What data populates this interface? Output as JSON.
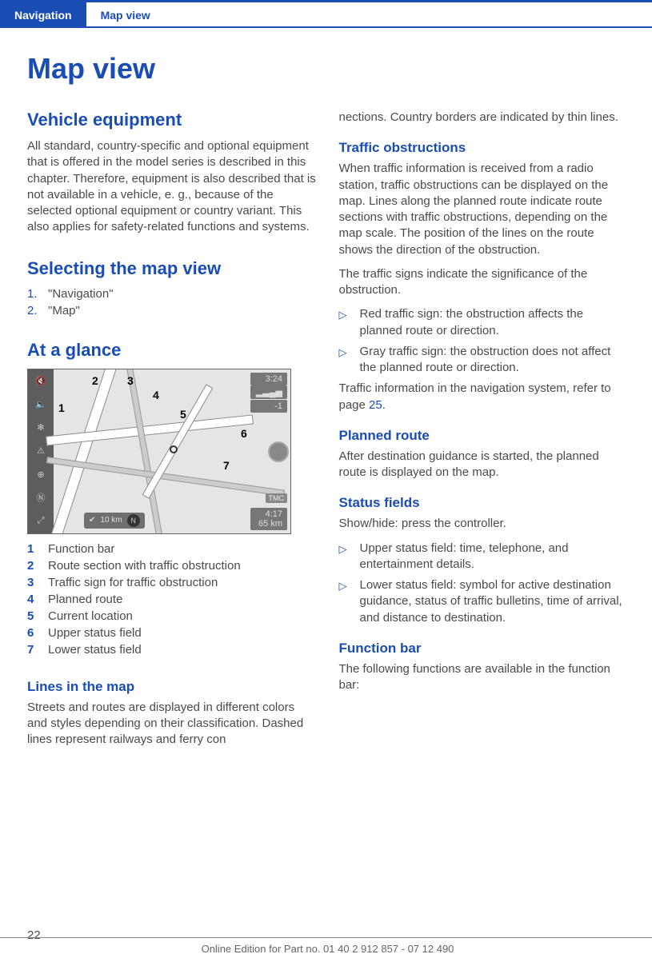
{
  "tabs": {
    "primary": "Navigation",
    "secondary": "Map view"
  },
  "title": "Map view",
  "vehicle_equipment": {
    "heading": "Vehicle equipment",
    "body": "All standard, country-specific and optional equipment that is offered in the model series is described in this chapter. Therefore, equipment is also described that is not available in a vehicle, e. g., because of the selected optional equipment or country variant. This also applies for safety-related functions and systems."
  },
  "selecting": {
    "heading": "Selecting the map view",
    "steps": [
      {
        "num": "1.",
        "text": "\"Navigation\""
      },
      {
        "num": "2.",
        "text": "\"Map\""
      }
    ]
  },
  "glance": {
    "heading": "At a glance",
    "status": {
      "time": "3:24",
      "signal": "▂▃▄▅",
      "temp": "-1",
      "tmc": "TMC",
      "eta": "4:17",
      "dist": "65 km",
      "scale": "10 km",
      "compass": "N"
    },
    "callouts": [
      "1",
      "2",
      "3",
      "4",
      "5",
      "6",
      "7"
    ],
    "legend": [
      {
        "num": "1",
        "text": "Function bar"
      },
      {
        "num": "2",
        "text": "Route section with traffic obstruction"
      },
      {
        "num": "3",
        "text": "Traffic sign for traffic obstruction"
      },
      {
        "num": "4",
        "text": "Planned route"
      },
      {
        "num": "5",
        "text": "Current location"
      },
      {
        "num": "6",
        "text": "Upper status field"
      },
      {
        "num": "7",
        "text": "Lower status field"
      }
    ]
  },
  "lines_in_map": {
    "heading": "Lines in the map",
    "body_1": "Streets and routes are displayed in different colors and styles depending on their classification. Dashed lines represent railways and ferry con",
    "body_2_cont": "nections. Country borders are indicated by thin lines."
  },
  "traffic": {
    "heading": "Traffic obstructions",
    "p1": "When traffic information is received from a radio station, traffic obstructions can be displayed on the map. Lines along the planned route indicate route sections with traffic obstructions, depending on the map scale. The position of the lines on the route shows the direction of the obstruction.",
    "p2": "The traffic signs indicate the significance of the obstruction.",
    "bullets": [
      "Red traffic sign: the obstruction affects the planned route or direction.",
      "Gray traffic sign: the obstruction does not affect the planned route or direction."
    ],
    "p3_pre": "Traffic information in the navigation system, refer to page ",
    "p3_link": "25",
    "p3_post": "."
  },
  "planned_route": {
    "heading": "Planned route",
    "body": "After destination guidance is started, the planned route is displayed on the map."
  },
  "status_fields": {
    "heading": "Status fields",
    "intro": "Show/hide: press the controller.",
    "bullets": [
      "Upper status field: time, telephone, and entertainment details.",
      "Lower status field: symbol for active destination guidance, status of traffic bulletins, time of arrival, and distance to destination."
    ]
  },
  "function_bar": {
    "heading": "Function bar",
    "body": "The following functions are available in the function bar:"
  },
  "footer": {
    "page": "22",
    "line": "Online Edition for Part no. 01 40 2 912 857 - 07 12 490"
  }
}
